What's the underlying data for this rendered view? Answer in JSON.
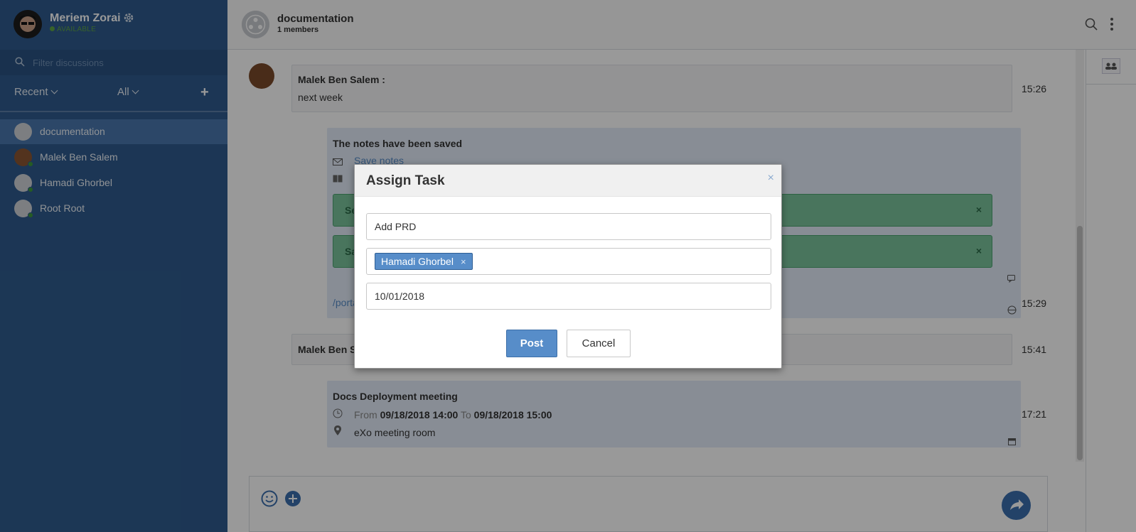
{
  "user": {
    "name": "Meriem Zorai",
    "status": "AVAILABLE"
  },
  "sidebar": {
    "filter_placeholder": "Filter discussions",
    "recent_label": "Recent",
    "all_label": "All",
    "add_label": "+",
    "items": [
      {
        "label": "documentation"
      },
      {
        "label": "Malek Ben Salem"
      },
      {
        "label": "Hamadi Ghorbel"
      },
      {
        "label": "Root Root"
      }
    ]
  },
  "header": {
    "room_name": "documentation",
    "members": "1 members"
  },
  "messages": {
    "m1": {
      "author": "Malek Ben Salem :",
      "text": "next week",
      "time": "15:26"
    },
    "m2": {
      "title": "The notes have been saved",
      "link": "Save notes",
      "green1_partial": "Se",
      "green2_partial": "Sa",
      "time": "15:29",
      "url_partial": "/porta"
    },
    "m3": {
      "author_partial": "Malek Ben S",
      "time": "15:41"
    },
    "m4": {
      "title": "Docs Deployment meeting",
      "from_label": "From",
      "from_value": "09/18/2018 14:00",
      "to_label": "To",
      "to_value": "09/18/2018 15:00",
      "location": "eXo meeting room",
      "time": "17:21"
    }
  },
  "modal": {
    "title": "Assign Task",
    "close": "×",
    "task_value": "Add PRD",
    "assignee_tag": "Hamadi Ghorbel",
    "tag_remove": "×",
    "date_value": "10/01/2018",
    "post_label": "Post",
    "cancel_label": "Cancel"
  },
  "colors": {
    "sidebar_bg": "#2f5b8e",
    "accent": "#578dc9",
    "online": "#3f9a3b"
  }
}
